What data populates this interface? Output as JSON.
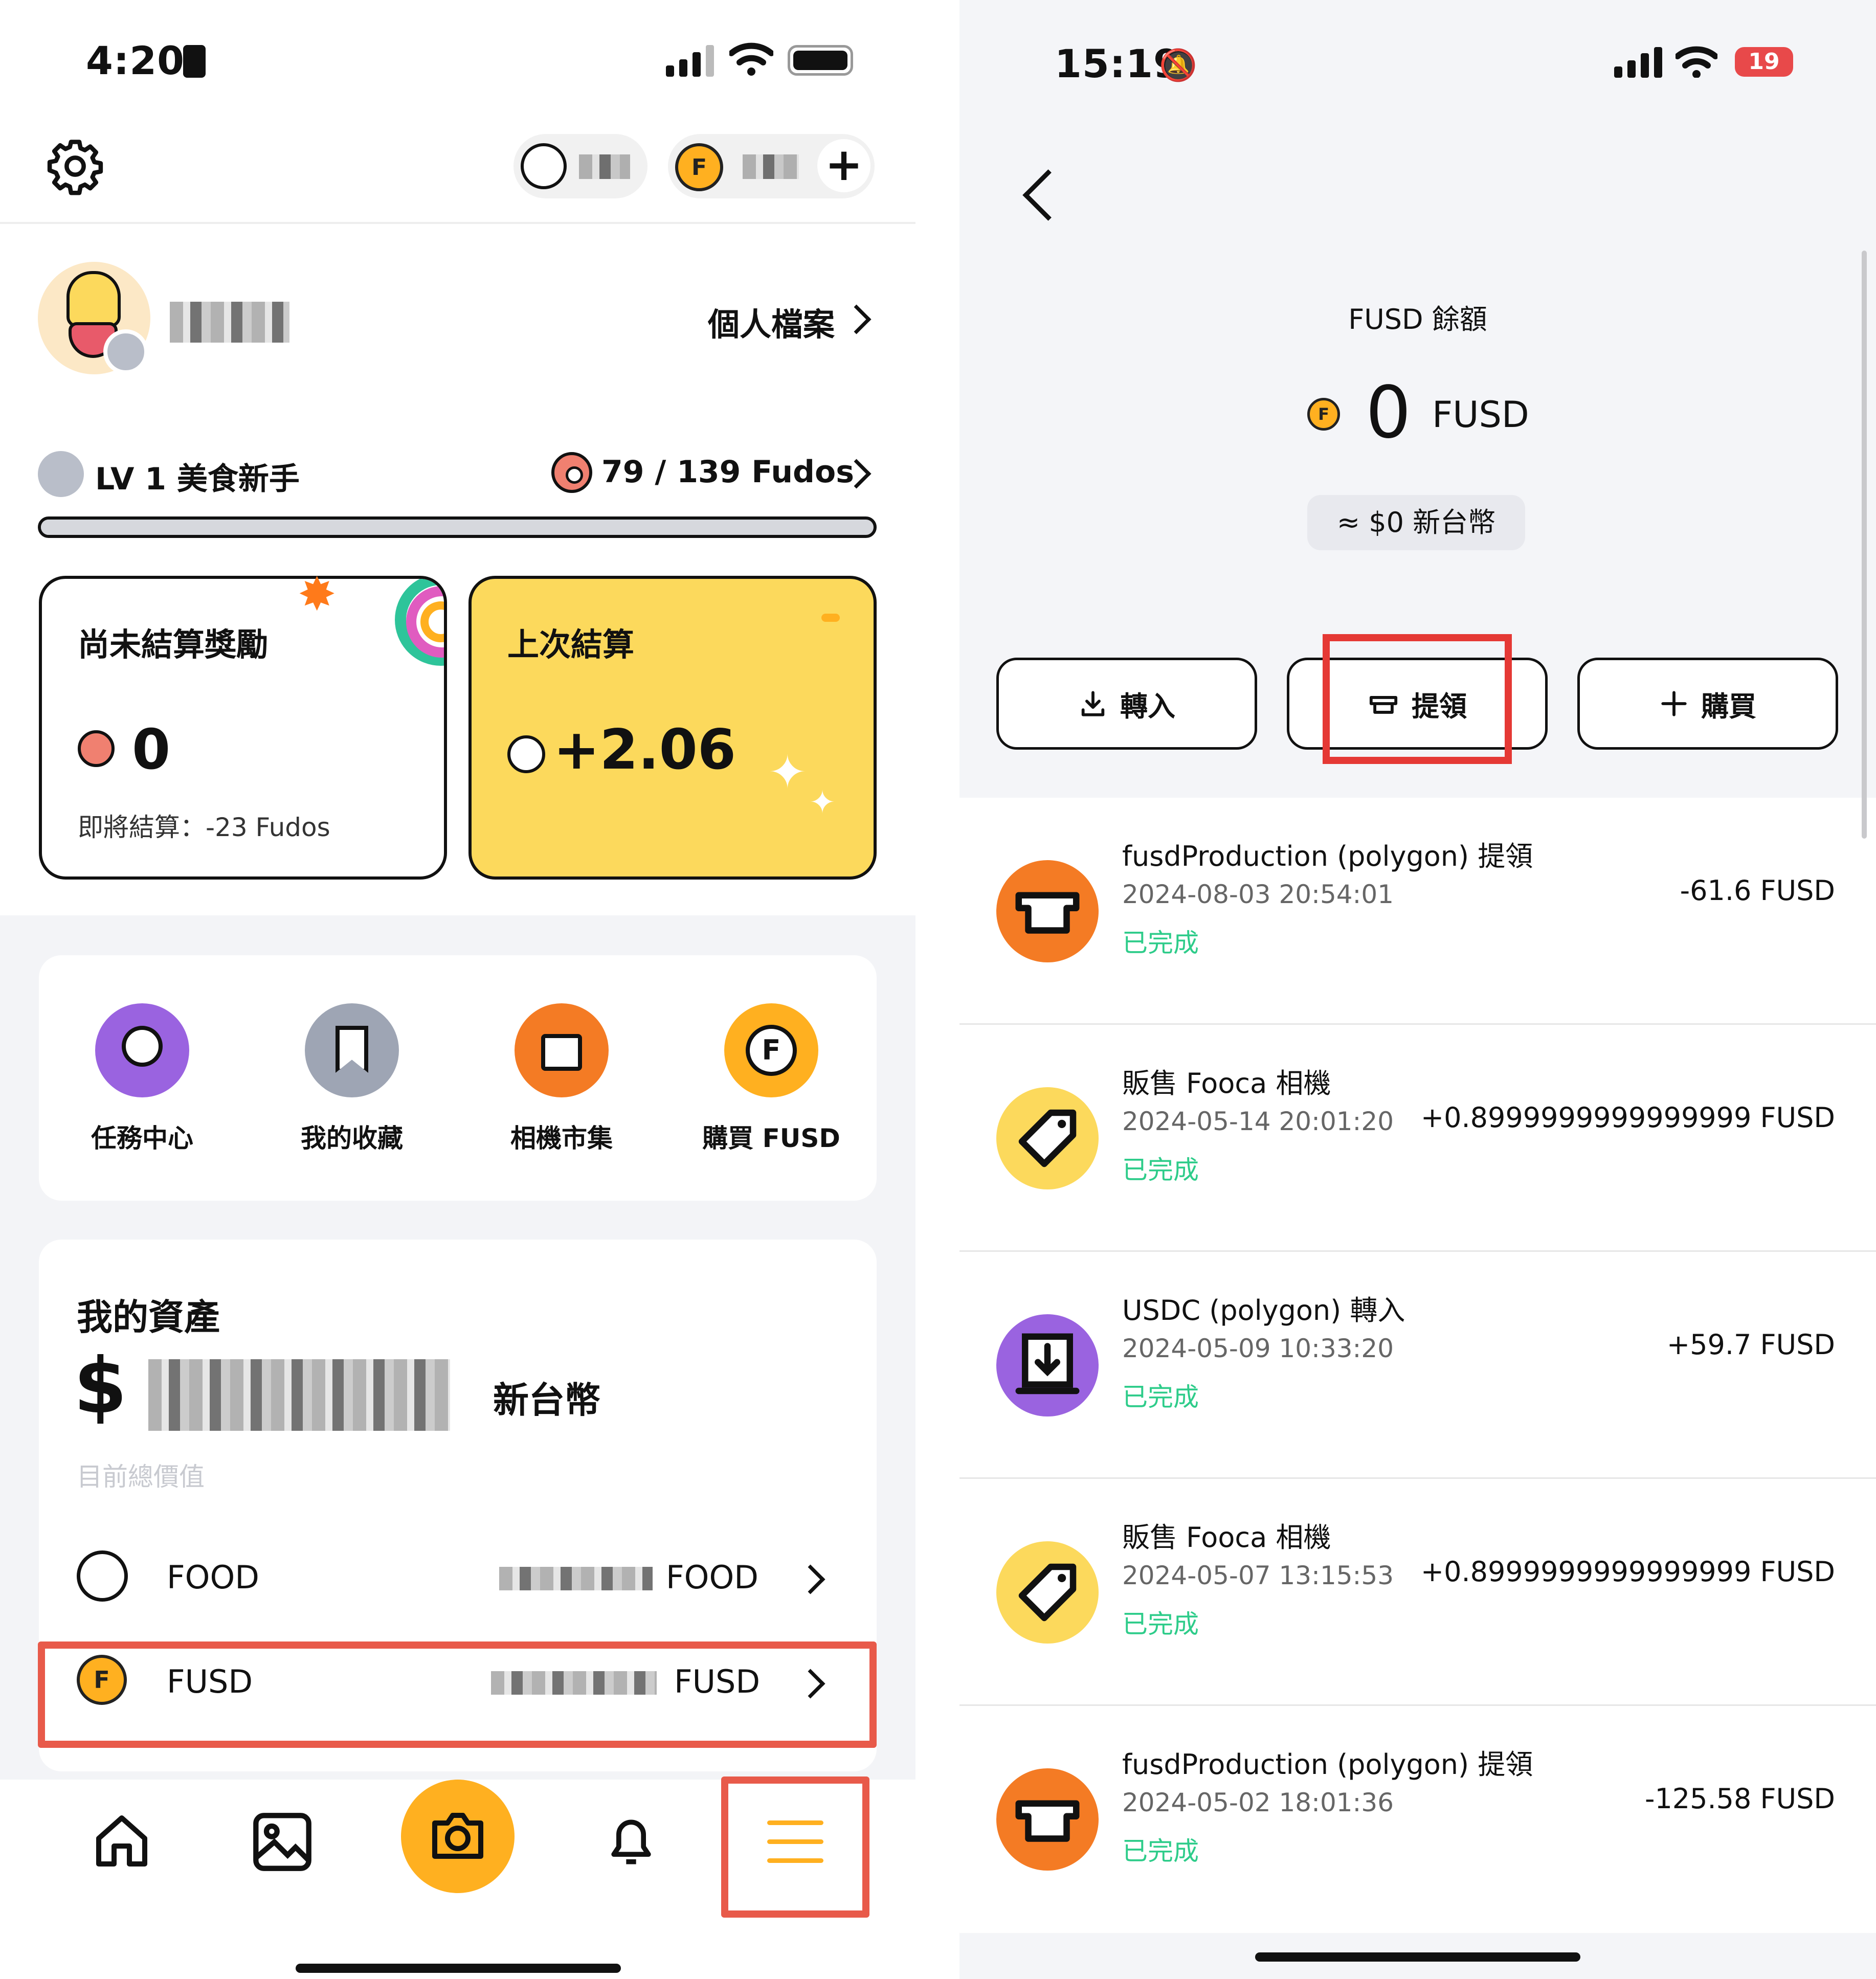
{
  "left": {
    "status_time": "4:20",
    "profile_link": "個人檔案",
    "level_label": "LV 1 美食新手",
    "fudos_progress": "79 / 139 Fudos",
    "fudos_progress_fraction": 0.57,
    "pending_card": {
      "title": "尚未結算獎勵",
      "value": "0",
      "note": "即將結算：-23 Fudos"
    },
    "last_card": {
      "title": "上次結算",
      "value": "+2.06"
    },
    "grid": [
      {
        "label": "任務中心",
        "icon": "medal-icon"
      },
      {
        "label": "我的收藏",
        "icon": "bookmark-icon"
      },
      {
        "label": "相機市集",
        "icon": "shopping-bag-icon"
      },
      {
        "label": "購買 FUSD",
        "icon": "fusd-coin-icon"
      }
    ],
    "assets": {
      "title": "我的資產",
      "currency_symbol": "$",
      "currency_name": "新台幣",
      "subtitle": "目前總價值",
      "rows": [
        {
          "name": "FOOD",
          "unit": "FOOD"
        },
        {
          "name": "FUSD",
          "unit": "FUSD"
        }
      ]
    },
    "coin_letter": "F",
    "colors": {
      "accent": "#ffb020",
      "yellow_card": "#fcd95c",
      "highlight": "#e53935"
    }
  },
  "right": {
    "status_time": "15:19",
    "battery": "19",
    "balance_title": "FUSD 餘額",
    "balance_value": "0",
    "balance_unit": "FUSD",
    "fiat_equiv": "≈  $0 新台幣",
    "actions": {
      "deposit": "轉入",
      "withdraw": "提領",
      "buy": "購買"
    },
    "transactions": [
      {
        "title": "fusdProduction (polygon) 提領",
        "date": "2024-08-03 20:54:01",
        "status": "已完成",
        "amount": "-61.6 FUSD",
        "icon": "withdraw-icon",
        "color": "#f47b24"
      },
      {
        "title": "販售 Fooca 相機",
        "date": "2024-05-14 20:01:20",
        "status": "已完成",
        "amount": "+0.8999999999999999 FUSD",
        "icon": "tag-icon",
        "color": "#fcd95c"
      },
      {
        "title": "USDC (polygon) 轉入",
        "date": "2024-05-09 10:33:20",
        "status": "已完成",
        "amount": "+59.7 FUSD",
        "icon": "deposit-icon",
        "color": "#9a63e0"
      },
      {
        "title": "販售 Fooca 相機",
        "date": "2024-05-07 13:15:53",
        "status": "已完成",
        "amount": "+0.8999999999999999 FUSD",
        "icon": "tag-icon",
        "color": "#fcd95c"
      },
      {
        "title": "fusdProduction (polygon) 提領",
        "date": "2024-05-02 18:01:36",
        "status": "已完成",
        "amount": "-125.58 FUSD",
        "icon": "withdraw-icon",
        "color": "#f47b24"
      }
    ]
  }
}
